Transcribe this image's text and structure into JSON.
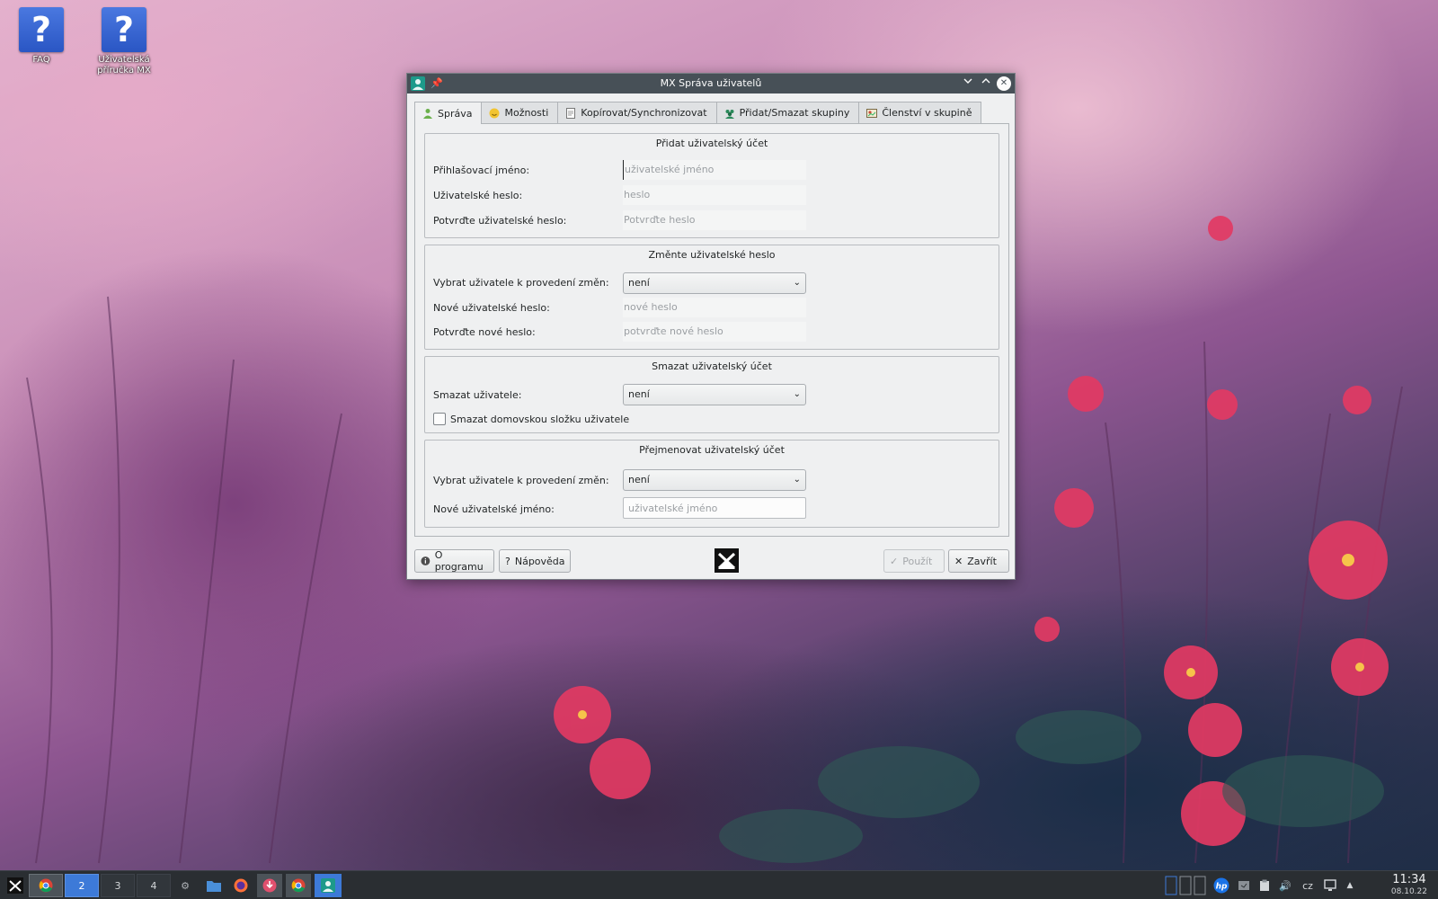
{
  "desktop": {
    "icons": [
      {
        "label": "FAQ",
        "glyph": "?"
      },
      {
        "label": "Uživatelská příručka MX",
        "glyph": "?"
      }
    ]
  },
  "window": {
    "title": "MX Správa uživatelů",
    "tabs": [
      {
        "label": "Správa",
        "icon": "user-icon",
        "active": true
      },
      {
        "label": "Možnosti",
        "icon": "smiley-icon"
      },
      {
        "label": "Kopírovat/Synchronizovat",
        "icon": "document-icon"
      },
      {
        "label": "Přidat/Smazat skupiny",
        "icon": "group-icon"
      },
      {
        "label": "Členství v skupině",
        "icon": "membership-icon"
      }
    ],
    "add_user": {
      "title": "Přidat uživatelský účet",
      "login_label": "Přihlašovací jméno:",
      "login_placeholder": "uživatelské jméno",
      "password_label": "Uživatelské heslo:",
      "password_placeholder": "heslo",
      "confirm_label": "Potvrďte uživatelské heslo:",
      "confirm_placeholder": "Potvrďte heslo"
    },
    "change_password": {
      "title": "Změnte uživatelské heslo",
      "select_label": "Vybrat uživatele k provedení změn:",
      "select_value": "není",
      "new_label": "Nové uživatelské heslo:",
      "new_placeholder": "nové heslo",
      "confirm_label": "Potvrďte nové heslo:",
      "confirm_placeholder": "potvrďte nové heslo"
    },
    "delete_user": {
      "title": "Smazat uživatelský účet",
      "select_label": "Smazat uživatele:",
      "select_value": "není",
      "checkbox_label": "Smazat domovskou složku uživatele",
      "checked": false
    },
    "rename_user": {
      "title": "Přejmenovat uživatelský účet",
      "select_label": "Vybrat uživatele k provedení změn:",
      "select_value": "není",
      "new_label": "Nové uživatelské jméno:",
      "new_placeholder": "uživatelské jméno"
    },
    "buttons": {
      "about": "O programu",
      "help": "Nápověda",
      "apply": "Použít",
      "close": "Zavřít"
    }
  },
  "taskbar": {
    "pager": [
      "2",
      "3",
      "4"
    ],
    "active_desktop": "2",
    "keyboard_layout": "cz",
    "time": "11:34",
    "date": "08.10.22"
  },
  "colors": {
    "titlebar": "#475057",
    "window_bg": "#eff0f1",
    "taskbar": "#2a2e32",
    "pager_active": "#3d7ad8",
    "desktop_icon": "#2a56c4"
  }
}
